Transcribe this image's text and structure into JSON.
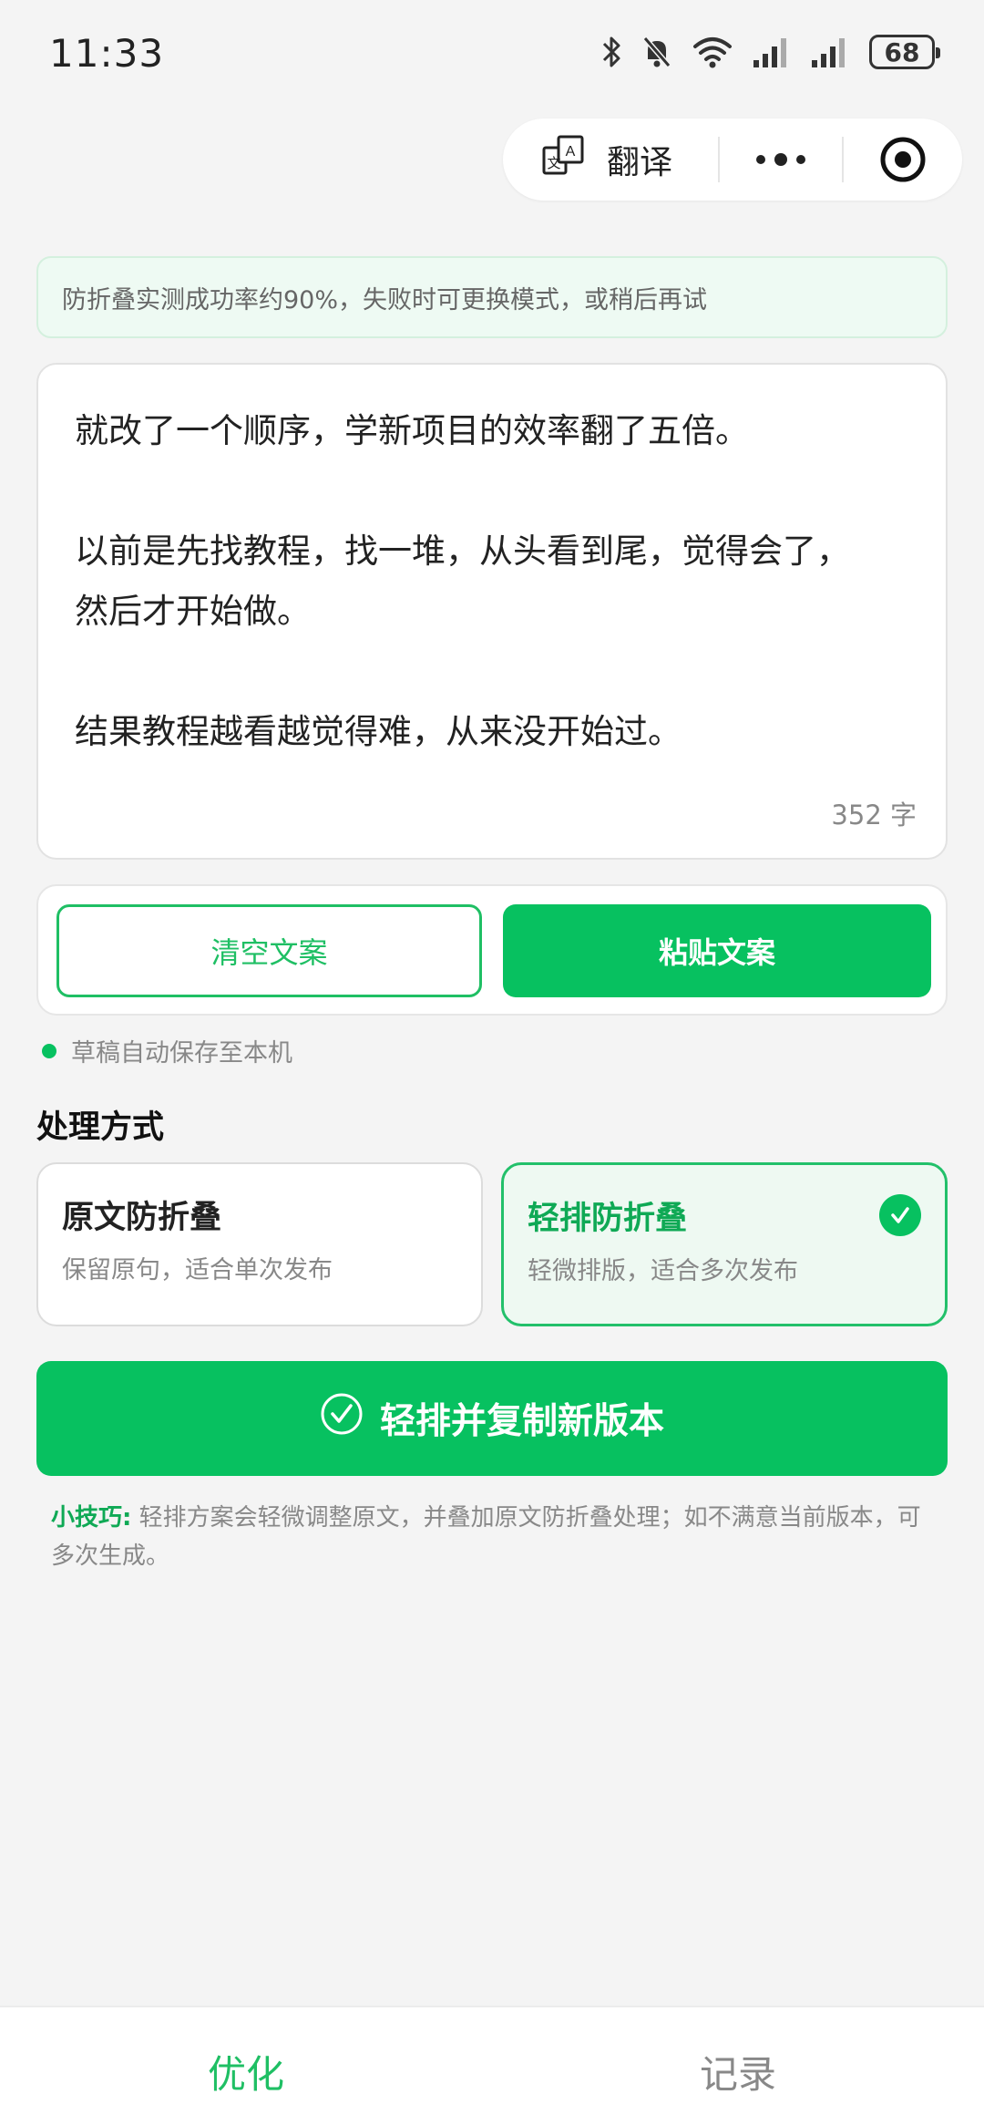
{
  "status_bar": {
    "time": "11:33",
    "battery": "68",
    "icons": [
      "bluetooth-icon",
      "mute-bell-icon",
      "wifi-icon",
      "signal-icon",
      "signal-icon",
      "battery-icon"
    ]
  },
  "capsule": {
    "translate_label": "翻译",
    "icons": [
      "translate-icon",
      "more-icon",
      "close-mini-program-icon"
    ]
  },
  "notice": {
    "text": "防折叠实测成功率约90%，失败时可更换模式，或稍后再试"
  },
  "editor": {
    "paragraphs": [
      [
        "就改了一个顺序，学新项目的效率翻了五倍。"
      ],
      [
        "以前是先找教程，找一堆，从头看到尾，觉得会了，",
        "然后才开始做。"
      ],
      [
        "结果教程越看越觉得难，从来没开始过。"
      ]
    ],
    "char_count": "352 字"
  },
  "actions": {
    "clear_label": "清空文案",
    "paste_label": "粘贴文案"
  },
  "autosave": {
    "text": "草稿自动保存至本机"
  },
  "section": {
    "title": "处理方式"
  },
  "modes": [
    {
      "title": "原文防折叠",
      "desc": "保留原句，适合单次发布",
      "selected": false
    },
    {
      "title": "轻排防折叠",
      "desc": "轻微排版，适合多次发布",
      "selected": true
    }
  ],
  "cta": {
    "label": "轻排并复制新版本"
  },
  "tip": {
    "prefix": "小技巧:",
    "text": " 轻排方案会轻微调整原文，并叠加原文防折叠处理；如不满意当前版本，可多次生成。"
  },
  "tabbar": {
    "tabs": [
      {
        "label": "优化",
        "active": true
      },
      {
        "label": "记录",
        "active": false
      }
    ]
  },
  "colors": {
    "accent": "#07c160",
    "accent_text": "#0fa955",
    "notice_bg": "#eefaf3",
    "page_bg": "#f4f4f4"
  }
}
